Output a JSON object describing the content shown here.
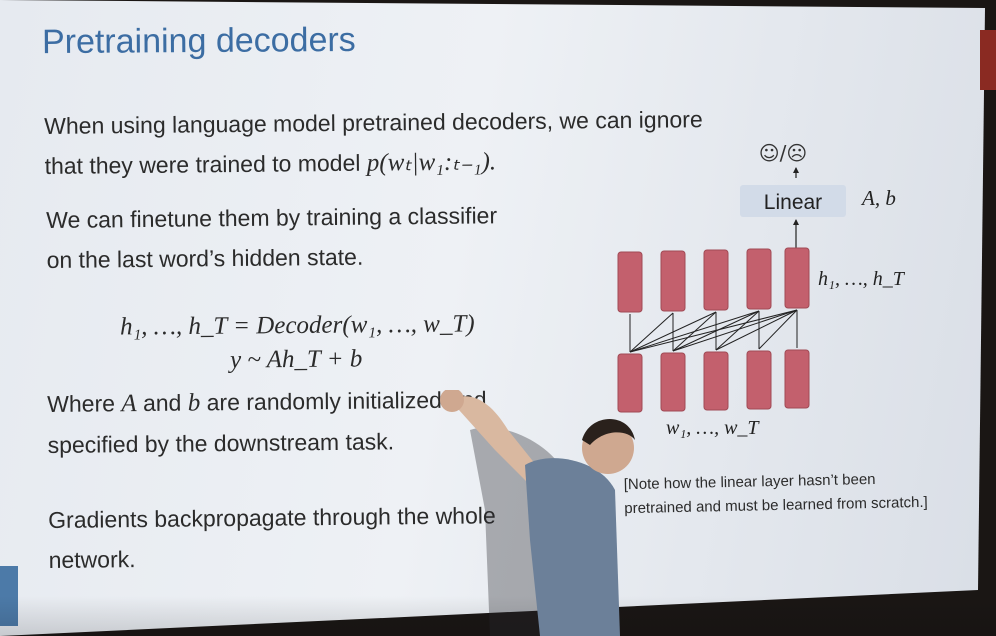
{
  "slide": {
    "title": "Pretraining decoders",
    "para1_line1": "When using language model pretrained decoders, we can ignore",
    "para1_line2_pre": "that they were trained to model ",
    "para1_math": "p(wₜ|w₁:ₜ₋₁).",
    "para2_line1": "We can finetune them by training a classifier",
    "para2_line2": "on the last word’s hidden state.",
    "eq1": "h₁, …, h_T = Decoder(w₁, …, w_T)",
    "eq2": "y ~ Ah_T + b",
    "para3_line1_pre": "Where ",
    "para3_A": "A",
    "para3_mid": " and ",
    "para3_b": "b",
    "para3_line1_post": " are randomly initialized and",
    "para3_line2": "specified by the downstream task.",
    "para4_line1": "Gradients backpropagate through the whole",
    "para4_line2": "network.",
    "note_line1": "[Note how the linear layer hasn’t been",
    "note_line2": "pretrained and must be learned from scratch.]"
  },
  "diagram": {
    "output_label": "☺/☹",
    "linear_label": "Linear",
    "params_label": "A, b",
    "hidden_label": "h₁, …, h_T",
    "input_label": "w₁, …, w_T",
    "colors": {
      "block": "#c3606d",
      "block_stroke": "#a04a55",
      "linear_box": "#d2dbe8",
      "arrow": "#222222"
    }
  }
}
